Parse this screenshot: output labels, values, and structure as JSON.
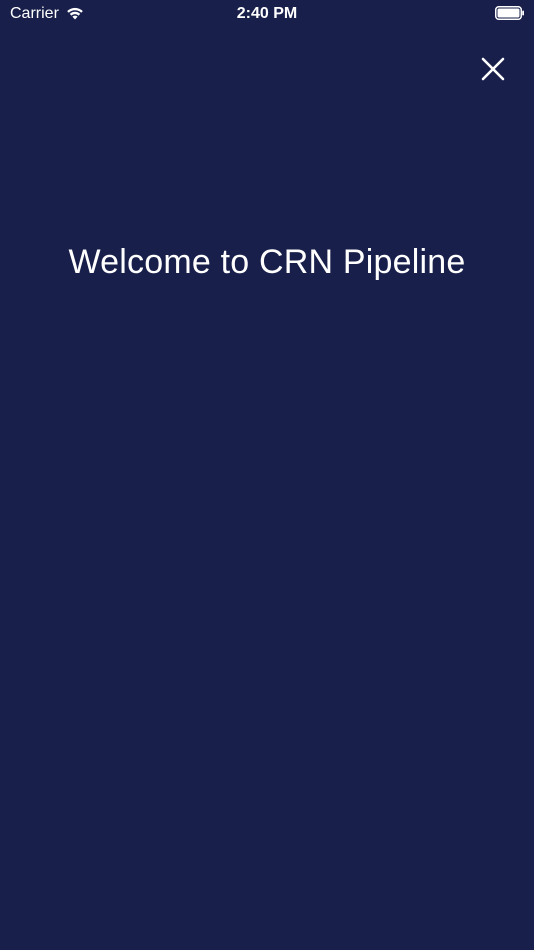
{
  "status_bar": {
    "carrier": "Carrier",
    "time": "2:40 PM",
    "icons": {
      "wifi": "wifi-icon",
      "battery": "battery-icon"
    }
  },
  "header": {
    "close_icon": "close-icon"
  },
  "main": {
    "title": "Welcome to CRN Pipeline"
  },
  "colors": {
    "background": "#171f4a",
    "text": "#ffffff"
  }
}
